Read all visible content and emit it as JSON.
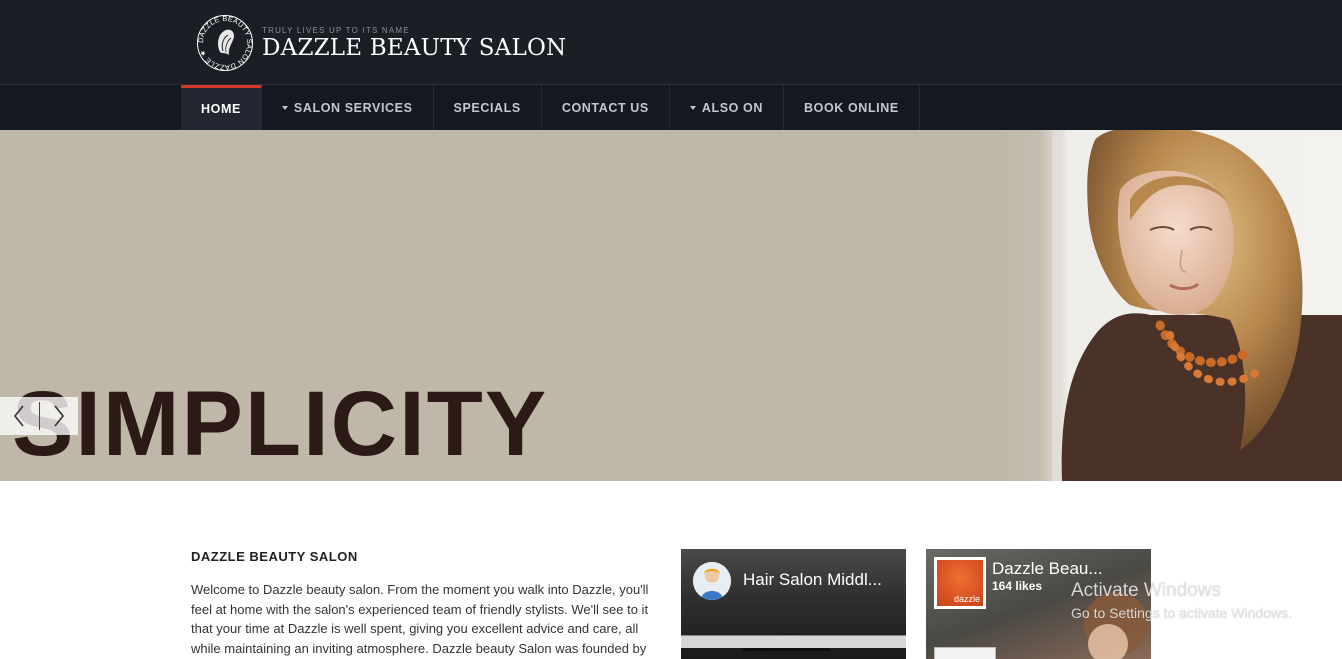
{
  "header": {
    "tagline": "TRULY LIVES UP TO ITS NAME",
    "title": "DAZZLE BEAUTY SALON",
    "emblem_text": "DAZZLE BEAUTY SALON DAZZLE ★"
  },
  "nav": {
    "items": [
      {
        "label": "HOME",
        "active": true,
        "dropdown": false
      },
      {
        "label": "SALON SERVICES",
        "active": false,
        "dropdown": true
      },
      {
        "label": "SPECIALS",
        "active": false,
        "dropdown": false
      },
      {
        "label": "CONTACT US",
        "active": false,
        "dropdown": false
      },
      {
        "label": "ALSO ON",
        "active": false,
        "dropdown": true
      },
      {
        "label": "BOOK ONLINE",
        "active": false,
        "dropdown": false
      }
    ],
    "accent_color": "#d23a2c"
  },
  "hero": {
    "word": "SIMPLICITY",
    "background_color": "#bfb8a8",
    "prev_icon": "chevron-left-icon",
    "next_icon": "chevron-right-icon"
  },
  "content": {
    "title": "DAZZLE BEAUTY SALON",
    "intro": "Welcome to Dazzle beauty salon. From the moment you walk into Dazzle, you'll feel at home with the salon's experienced team of friendly stylists. We'll see to it that your time at Dazzle is well spent, giving you excellent advice and care, all while maintaining an inviting atmosphere. Dazzle beauty Salon was founded by"
  },
  "widgets": {
    "left": {
      "title": "Hair Salon Middl..."
    },
    "right": {
      "title": "Dazzle Beau...",
      "likes": "164 likes",
      "avatar_brand": "dazzle"
    }
  },
  "os_overlay": {
    "title": "Activate Windows",
    "subtitle": "Go to Settings to activate Windows."
  }
}
